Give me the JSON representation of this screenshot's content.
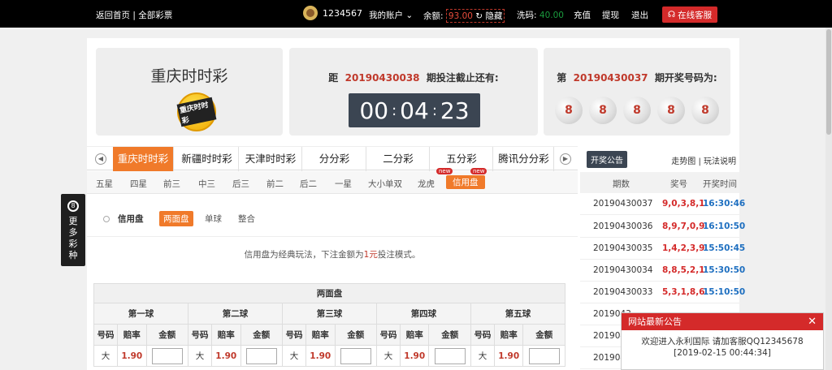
{
  "topbar": {
    "home": "返回首页",
    "sep": "|",
    "all_games": "全部彩票",
    "user_id": "1234567",
    "my_account": "我的账户",
    "balance_label": "余额:",
    "balance_value": "93.00",
    "hide_label": "隐藏",
    "wash_label": "洗码:",
    "wash_value": "40.00",
    "deposit": "充值",
    "withdraw": "提现",
    "logout": "退出",
    "service": "在线客服"
  },
  "game": {
    "name": "重庆时时彩",
    "logo_text": "重庆时时彩"
  },
  "countdown": {
    "prefix": "距",
    "period": "20190430038",
    "suffix": "期投注截止还有:",
    "hh": "00",
    "mm": "04",
    "ss": "23",
    "colon": ":"
  },
  "draw": {
    "prefix": "第",
    "period": "20190430037",
    "suffix": "期开奖号码为:"
  },
  "game_tabs": [
    "重庆时时彩",
    "新疆时时彩",
    "天津时时彩",
    "分分彩",
    "二分彩",
    "五分彩",
    "腾讯分分彩"
  ],
  "sub_tabs": [
    "五星",
    "四星",
    "前三",
    "中三",
    "后三",
    "前二",
    "后二",
    "一星",
    "大小单双",
    "龙虎",
    "信用盘"
  ],
  "new_tag": "new",
  "modes": {
    "title": "信用盘",
    "items": [
      "两面盘",
      "单球",
      "整合"
    ]
  },
  "description": {
    "before": "信用盘为经典玩法，下注金额为",
    "highlight": "1元",
    "after": "投注模式。"
  },
  "bet_table": {
    "title": "两面盘",
    "balls": [
      "第一球",
      "第二球",
      "第三球",
      "第四球",
      "第五球"
    ],
    "cols": [
      "号码",
      "赔率",
      "金额"
    ],
    "row": {
      "code": "大",
      "odds": "1.90"
    }
  },
  "side": {
    "notice_btn": "开奖公告",
    "trend": "走势图",
    "sep": "|",
    "rules": "玩法说明",
    "headers": [
      "期数",
      "奖号",
      "开奖时间"
    ],
    "rows": [
      {
        "period": "20190430037",
        "nums": "9,0,3,8,1",
        "time": "16:30:46"
      },
      {
        "period": "20190430036",
        "nums": "8,9,7,0,9",
        "time": "16:10:50"
      },
      {
        "period": "20190430035",
        "nums": "1,4,2,3,9",
        "time": "15:50:45"
      },
      {
        "period": "20190430034",
        "nums": "8,8,5,2,1",
        "time": "15:30:50"
      },
      {
        "period": "20190430033",
        "nums": "5,3,1,8,6",
        "time": "15:10:50"
      },
      {
        "period": "2019043",
        "nums": "",
        "time": ""
      },
      {
        "period": "2019043",
        "nums": "",
        "time": ""
      },
      {
        "period": "2019043",
        "nums": "",
        "time": ""
      }
    ]
  },
  "more_games": {
    "icon_text": "8",
    "label": "更多彩种"
  },
  "popup": {
    "title": "网站最新公告",
    "close": "✕",
    "message": "欢迎进入永利国际 请加客服QQ12345678",
    "date": "[2019-02-15 00:44:34]"
  },
  "colors": {
    "accent": "#f07a2a",
    "brand_red": "#d42a2a",
    "timer_bg": "#3b4552"
  }
}
